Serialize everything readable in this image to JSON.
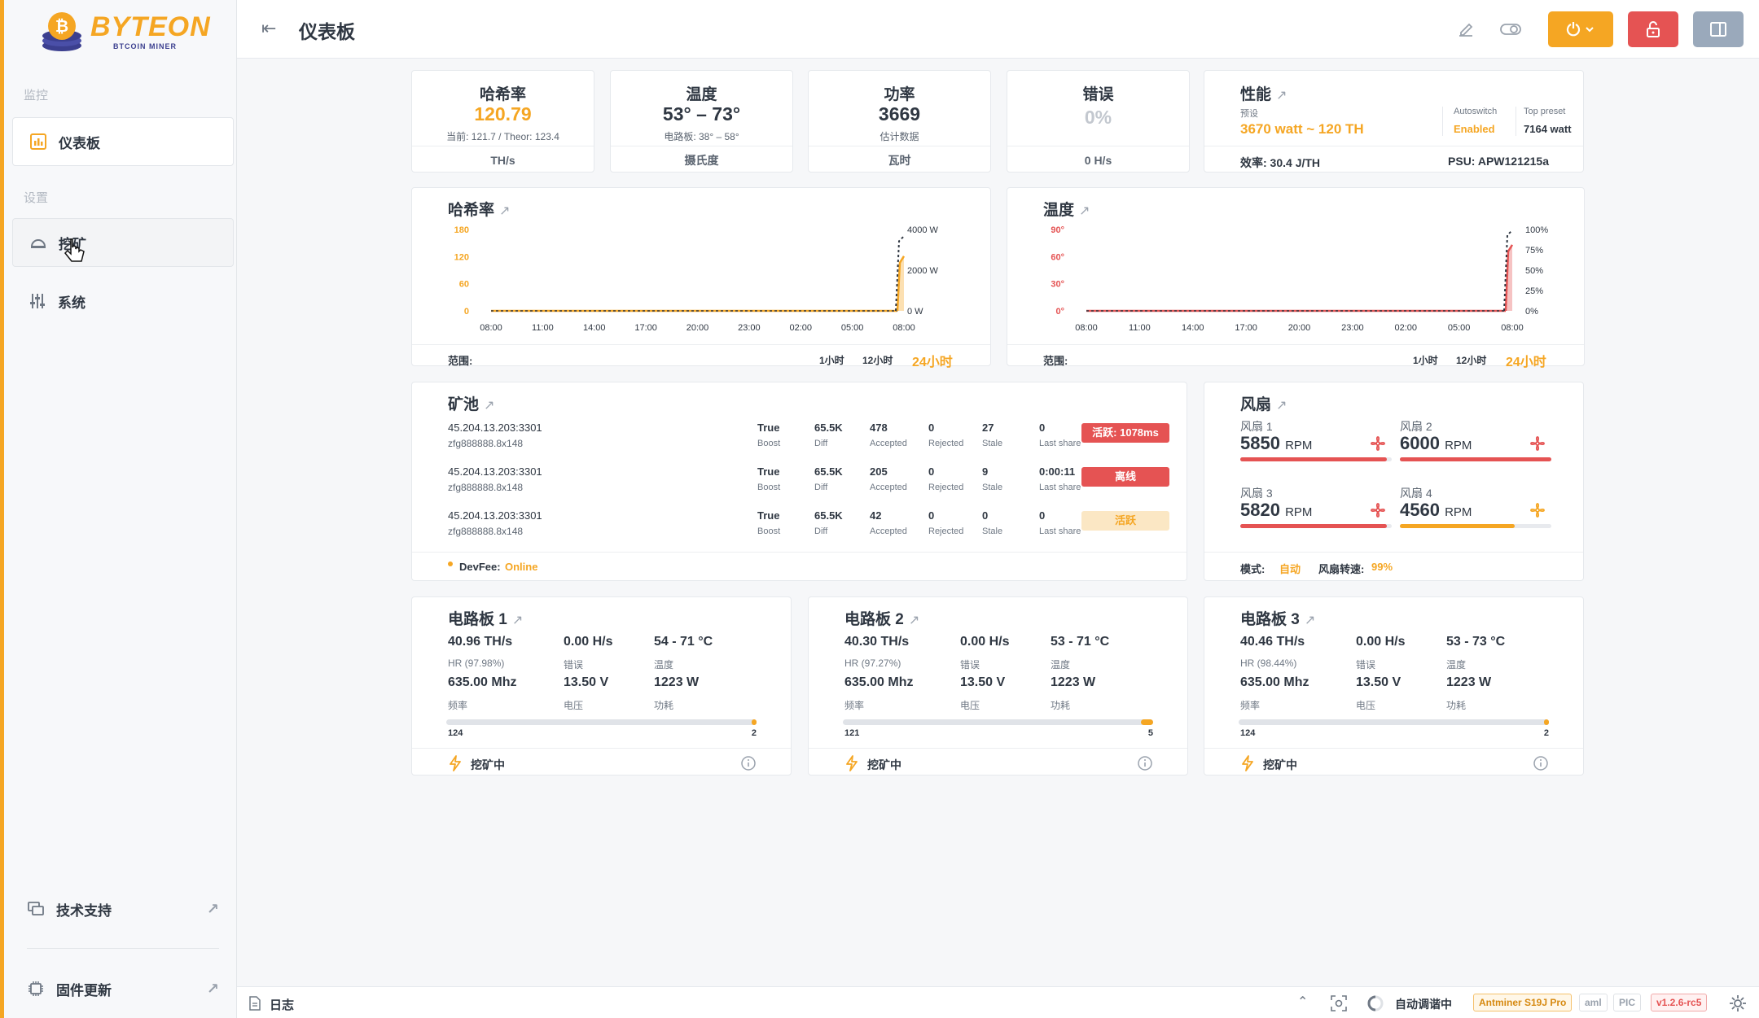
{
  "brand": {
    "name": "BYTEON",
    "tagline": "BTCOIN MINER"
  },
  "sidebar": {
    "section_monitor": "监控",
    "dashboard": "仪表板",
    "section_settings": "设置",
    "mining": "挖矿",
    "system": "系统",
    "support": "技术支持",
    "firmware": "固件更新"
  },
  "header": {
    "title": "仪表板"
  },
  "stats": {
    "hashrate": {
      "title": "哈希率",
      "value": "120.79",
      "sub": "当前: 121.7 / Theor: 123.4",
      "unit": "TH/s"
    },
    "temperature": {
      "title": "温度",
      "value": "53° – 73°",
      "sub": "电路板:  38° – 58°",
      "unit": "摄氏度"
    },
    "power": {
      "title": "功率",
      "value": "3669",
      "sub": "估计数据",
      "unit": "瓦时"
    },
    "errors": {
      "title": "错误",
      "value": "0%",
      "unit": "0 H/s"
    },
    "performance": {
      "title": "性能",
      "preset_label": "预设",
      "preset_value": "3670 watt ~ 120 TH",
      "autoswitch_label": "Autoswitch",
      "autoswitch_value": "Enabled",
      "top_preset_label": "Top preset",
      "top_preset_value": "7164 watt",
      "efficiency": "效率: 30.4 J/TH",
      "psu": "PSU: APW121215a"
    }
  },
  "hashrate_chart": {
    "title": "哈希率",
    "range_label": "范围:",
    "ranges": [
      "1小时",
      "12小时",
      "24小时"
    ],
    "active_range": "24小时"
  },
  "temperature_chart": {
    "title": "温度",
    "range_label": "范围:",
    "ranges": [
      "1小时",
      "12小时",
      "24小时"
    ],
    "active_range": "24小时"
  },
  "chart_data": [
    {
      "type": "line",
      "title": "哈希率",
      "x": [
        "08:00",
        "11:00",
        "14:00",
        "17:00",
        "20:00",
        "23:00",
        "02:00",
        "05:00",
        "08:00"
      ],
      "y_ticks_left": [
        "0",
        "60",
        "120",
        "180"
      ],
      "y_ticks_right": [
        "0 W",
        "2000 W",
        "4000 W"
      ],
      "ylim": [
        0,
        180
      ],
      "series": [
        {
          "values": [
            0,
            0,
            0,
            0,
            0,
            0,
            0,
            0,
            121
          ],
          "color": "#f5a623"
        },
        {
          "values": [
            0,
            0,
            0,
            0,
            0,
            0,
            0,
            0,
            3669
          ],
          "color": "#2f3742"
        }
      ]
    },
    {
      "type": "line",
      "title": "温度",
      "x": [
        "08:00",
        "11:00",
        "14:00",
        "17:00",
        "20:00",
        "23:00",
        "02:00",
        "05:00",
        "08:00"
      ],
      "y_ticks_left": [
        "0°",
        "30°",
        "60°",
        "90°"
      ],
      "y_ticks_right": [
        "0%",
        "25%",
        "50%",
        "75%",
        "100%"
      ],
      "ylim": [
        0,
        90
      ],
      "series": [
        {
          "values": [
            0,
            0,
            0,
            0,
            0,
            0,
            0,
            0,
            73
          ],
          "color": "#e55353"
        },
        {
          "values": [
            0,
            0,
            0,
            0,
            0,
            0,
            0,
            0,
            99
          ],
          "color": "#2f3742"
        }
      ]
    }
  ],
  "pools": {
    "title": "矿池",
    "labels": {
      "boost": "Boost",
      "diff": "Diff",
      "accepted": "Accepted",
      "rejected": "Rejected",
      "stale": "Stale",
      "last_share": "Last share"
    },
    "rows": [
      {
        "ip": "45.204.13.203:3301",
        "user": "zfg888888.8x148",
        "boost": "True",
        "diff": "65.5K",
        "accepted": "478",
        "rejected": "0",
        "stale": "27",
        "last_share": "0",
        "status": "活跃: 1078ms",
        "status_color": "#e55353"
      },
      {
        "ip": "45.204.13.203:3301",
        "user": "zfg888888.8x148",
        "boost": "True",
        "diff": "65.5K",
        "accepted": "205",
        "rejected": "0",
        "stale": "9",
        "last_share": "0:00:11",
        "status": "离线",
        "status_color": "#e55353"
      },
      {
        "ip": "45.204.13.203:3301",
        "user": "zfg888888.8x148",
        "boost": "True",
        "diff": "65.5K",
        "accepted": "42",
        "rejected": "0",
        "stale": "0",
        "last_share": "0",
        "status": "活跃",
        "status_color": "#fbe7c4"
      }
    ],
    "devfee_label": "DevFee:",
    "devfee_value": "Online"
  },
  "fans": {
    "title": "风扇",
    "rpm_unit": "RPM",
    "items": [
      {
        "name": "风扇 1",
        "rpm": "5850",
        "level": 0.97,
        "color": "#e55353"
      },
      {
        "name": "风扇 2",
        "rpm": "6000",
        "level": 1.0,
        "color": "#e55353"
      },
      {
        "name": "风扇 3",
        "rpm": "5820",
        "level": 0.97,
        "color": "#e55353"
      },
      {
        "name": "风扇 4",
        "rpm": "4560",
        "level": 0.76,
        "color": "#f5a623"
      }
    ],
    "mode_label": "模式:",
    "mode_value": "自动",
    "speed_label": "风扇转速:",
    "speed_value": "99%"
  },
  "boards": [
    {
      "title": "电路板 1",
      "hashrate": "40.96 TH/s",
      "hr_pct": "HR (97.98%)",
      "errors": "0.00 H/s",
      "errors_label": "错误",
      "temp": "54 - 71 °C",
      "temp_label": "温度",
      "freq": "635.00 Mhz",
      "freq_label": "频率",
      "voltage": "13.50 V",
      "voltage_label": "电压",
      "power": "1223 W",
      "power_label": "功耗",
      "chips_ok": "124",
      "chips_bad": "2",
      "bad_fraction": 0.016,
      "status": "挖矿中"
    },
    {
      "title": "电路板 2",
      "hashrate": "40.30 TH/s",
      "hr_pct": "HR (97.27%)",
      "errors": "0.00 H/s",
      "errors_label": "错误",
      "temp": "53 - 71 °C",
      "temp_label": "温度",
      "freq": "635.00 Mhz",
      "freq_label": "频率",
      "voltage": "13.50 V",
      "voltage_label": "电压",
      "power": "1223 W",
      "power_label": "功耗",
      "chips_ok": "121",
      "chips_bad": "5",
      "bad_fraction": 0.04,
      "status": "挖矿中"
    },
    {
      "title": "电路板 3",
      "hashrate": "40.46 TH/s",
      "hr_pct": "HR (98.44%)",
      "errors": "0.00 H/s",
      "errors_label": "错误",
      "temp": "53 - 73 °C",
      "temp_label": "温度",
      "freq": "635.00 Mhz",
      "freq_label": "频率",
      "voltage": "13.50 V",
      "voltage_label": "电压",
      "power": "1223 W",
      "power_label": "功耗",
      "chips_ok": "124",
      "chips_bad": "2",
      "bad_fraction": 0.016,
      "status": "挖矿中"
    }
  ],
  "statusbar": {
    "log": "日志",
    "autotune": "自动调谐中",
    "model": "Antminer S19J Pro",
    "chip1": "aml",
    "chip2": "PIC",
    "version": "v1.2.6-rc5"
  },
  "colors": {
    "accent": "#f5a623",
    "danger": "#e55353",
    "text": "#2f3742"
  }
}
